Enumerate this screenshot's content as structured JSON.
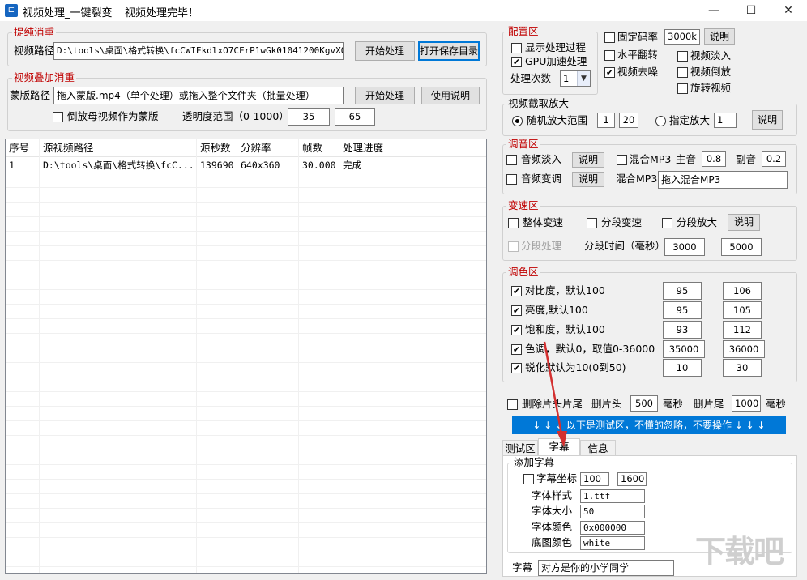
{
  "window": {
    "title": "视频处理_一键裂变",
    "status": "视频处理完毕！",
    "icon": "app-icon",
    "controls": {
      "minimize": "—",
      "maximize": "☐",
      "close": "✕"
    }
  },
  "extract": {
    "group_label": "提纯消重",
    "path_label": "视频路径",
    "path_value": "D:\\tools\\桌面\\格式转换\\fcCWIEkdlxO7CFrP1wGk01041200KgvXOE010",
    "start_button": "开始处理",
    "open_dir_button": "打开保存目录"
  },
  "overlay": {
    "group_label": "视频叠加消重",
    "mask_label": "蒙版路径",
    "mask_value": "拖入蒙版.mp4（单个处理）或拖入整个文件夹（批量处理）",
    "start_button": "开始处理",
    "help_button": "使用说明",
    "reverse_label": "倒放母视频作为蒙版",
    "opacity_label": "透明度范围（0-1000）",
    "opacity_min": "35",
    "opacity_max": "65"
  },
  "table": {
    "columns": [
      "序号",
      "源视频路径",
      "源秒数",
      "分辨率",
      "帧数",
      "处理进度"
    ],
    "rows": [
      [
        "1",
        "D:\\tools\\桌面\\格式转换\\fcC...",
        "139690",
        "640x360",
        "30.000",
        "完成"
      ]
    ]
  },
  "config": {
    "group_label": "配置区",
    "show_process": "显示处理过程",
    "gpu": "GPU加速处理",
    "count_label": "处理次数",
    "count_value": "1",
    "fixed_bitrate": "固定码率",
    "bitrate_value": "3000k",
    "help_button": "说明",
    "hflip": "水平翻转",
    "denoise": "视频去噪",
    "fade_in": "视频淡入",
    "reverse": "视频倒放",
    "rotate": "旋转视频"
  },
  "crop": {
    "group_label": "视频截取放大",
    "random_label": "随机放大范围",
    "random_min": "1",
    "random_max": "20",
    "fixed_label": "指定放大",
    "fixed_value": "1",
    "help_button": "说明"
  },
  "audio": {
    "group_label": "调音区",
    "fade_in": "音频淡入",
    "fade_help": "说明",
    "mix_mp3": "混合MP3",
    "main_label": "主音",
    "main_value": "0.8",
    "sub_label": "副音",
    "sub_value": "0.2",
    "pitch": "音频变调",
    "pitch_help": "说明",
    "mix_label": "混合MP3",
    "mix_value": "拖入混合MP3"
  },
  "speed": {
    "group_label": "变速区",
    "overall": "整体变速",
    "segment": "分段变速",
    "segment_zoom": "分段放大",
    "help_button": "说明",
    "segment_process": "分段处理",
    "segment_time_label": "分段时间（毫秒）",
    "time_min": "3000",
    "time_max": "5000"
  },
  "color": {
    "group_label": "调色区",
    "rows": [
      {
        "label": "对比度，默认100",
        "min": "95",
        "max": "106"
      },
      {
        "label": "亮度,默认100",
        "min": "95",
        "max": "105"
      },
      {
        "label": "饱和度，默认100",
        "min": "93",
        "max": "112"
      },
      {
        "label": "色调，默认0，取值0-36000",
        "min": "35000",
        "max": "36000"
      },
      {
        "label": "锐化默认为10(0到50)",
        "min": "10",
        "max": "30"
      }
    ]
  },
  "trim": {
    "label": "删除片头片尾",
    "head_label": "删片头",
    "head_value": "500",
    "head_unit": "毫秒",
    "tail_label": "删片尾",
    "tail_value": "1000",
    "tail_unit": "毫秒"
  },
  "banner": "↓ ↓ ↓ 以下是测试区，不懂的忽略，不要操作 ↓ ↓ ↓",
  "tabs": [
    "测试区",
    "字幕",
    "信息"
  ],
  "subtitle": {
    "group_label": "添加字幕",
    "coord_label": "字幕坐标",
    "coord_x": "100",
    "coord_y": "1600",
    "font_style_label": "字体样式",
    "font_style_value": "1.ttf",
    "font_size_label": "字体大小",
    "font_size_value": "50",
    "font_color_label": "字体颜色",
    "font_color_value": "0x000000",
    "bg_color_label": "底图颜色",
    "bg_color_value": "white",
    "text_label": "字幕",
    "text_value": "对方是你的小学同学"
  },
  "colors": {
    "accent": "#0078d7",
    "group_title": "#c00000",
    "annotation_arrow": "#d32f2f"
  }
}
